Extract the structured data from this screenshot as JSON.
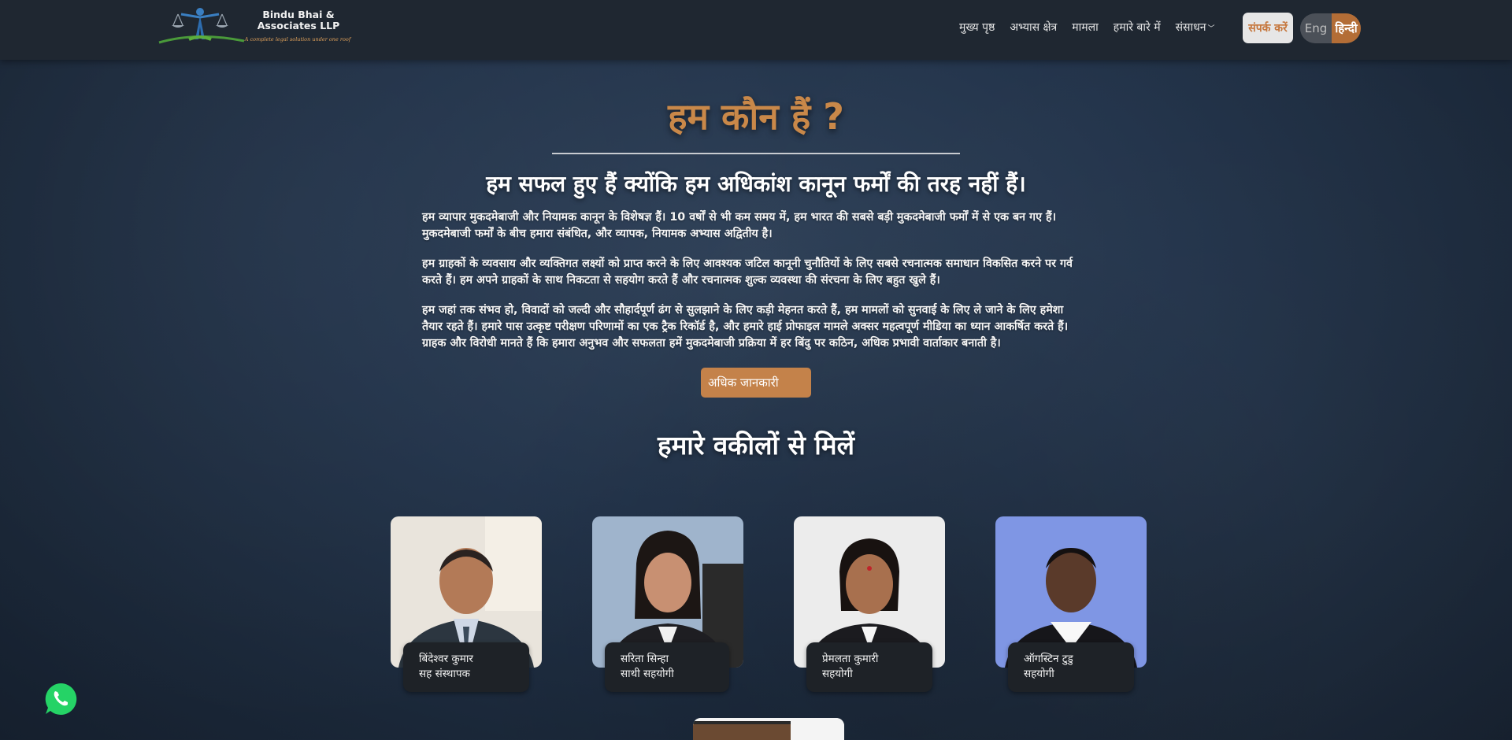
{
  "brand": {
    "name_line1": "Bindu Bhai &",
    "name_line2": "Associates LLP",
    "tagline": "A complete legal solution under one roof"
  },
  "nav": {
    "items": [
      {
        "label": "मुख्य पृष्ठ"
      },
      {
        "label": "अभ्यास क्षेत्र"
      },
      {
        "label": "मामला"
      },
      {
        "label": "हमारे बारे में"
      },
      {
        "label": "संसाधन"
      }
    ],
    "contact_label": "संपर्क करें",
    "lang_eng": "Eng",
    "lang_hindi": "हिन्दी"
  },
  "about": {
    "title": "हम कौन हैं ?",
    "subtitle": "हम सफल हुए हैं क्योंकि हम अधिकांश कानून फर्मों की तरह नहीं हैं।",
    "paragraphs": [
      "हम व्यापार मुकदमेबाजी और नियामक कानून के विशेषज्ञ हैं। 10 वर्षों से भी कम समय में, हम भारत की सबसे बड़ी मुकदमेबाजी फर्मों में से एक बन गए हैं। मुकदमेबाजी फर्मों के बीच हमारा संबंधित, और व्यापक, नियामक अभ्यास अद्वितीय है।",
      "हम ग्राहकों के व्यवसाय और व्यक्तिगत लक्ष्यों को प्राप्त करने के लिए आवश्यक जटिल कानूनी चुनौतियों के लिए सबसे रचनात्मक समाधान विकसित करने पर गर्व करते हैं। हम अपने ग्राहकों के साथ निकटता से सहयोग करते हैं और रचनात्मक शुल्क व्यवस्था की संरचना के लिए बहुत खुले हैं।",
      "हम जहां तक संभव हो, विवादों को जल्दी और सौहार्दपूर्ण ढंग से सुलझाने के लिए कड़ी मेहनत करते हैं, हम मामलों को सुनवाई के लिए ले जाने के लिए हमेशा तैयार रहते हैं। हमारे पास उत्कृष्ट परीक्षण परिणामों का एक ट्रैक रिकॉर्ड है, और हमारे हाई प्रोफाइल मामले अक्सर महत्वपूर्ण मीडिया का ध्यान आकर्षित करते हैं। ग्राहक और विरोधी मानते हैं कि हमारा अनुभव और सफलता हमें मुकदमेबाजी प्रक्रिया में हर बिंदु पर कठिन, अधिक प्रभावी वार्ताकार बनाती है।"
    ],
    "more_button": "अधिक जानकारी"
  },
  "lawyers": {
    "title": "हमारे वकीलों से मिलें",
    "members": [
      {
        "name": "बिंदेश्वर कुमार",
        "role": "सह संस्थापक",
        "bg": "#e9e4dc"
      },
      {
        "name": "सरिता सिन्हा",
        "role": "साथी सहयोगी",
        "bg": "#9fb4cc"
      },
      {
        "name": "प्रेमलता कुमारी",
        "role": "सहयोगी",
        "bg": "#ececec"
      },
      {
        "name": "ऑगस्टिन टुडु",
        "role": "सहयोगी",
        "bg": "#7f96e4"
      }
    ]
  },
  "colors": {
    "accent": "#c98849",
    "button": "#c4824a",
    "navbar": "#1f2731",
    "whatsapp": "#25d366"
  }
}
